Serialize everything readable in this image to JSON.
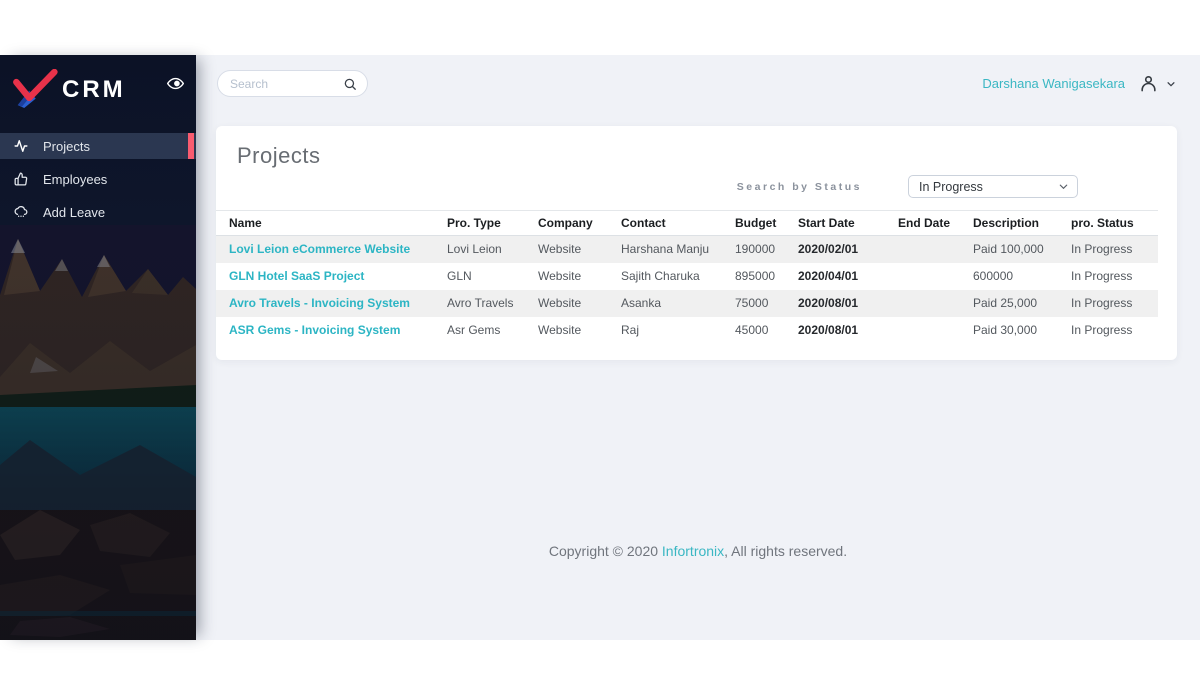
{
  "sidebar": {
    "brand": "CRM",
    "items": [
      {
        "label": "Projects",
        "active": true
      },
      {
        "label": "Employees",
        "active": false
      },
      {
        "label": "Add Leave",
        "active": false
      }
    ]
  },
  "topbar": {
    "search_placeholder": "Search",
    "user_name": "Darshana Wanigasekara"
  },
  "page": {
    "title": "Projects",
    "filter_label": "Search by Status",
    "filter_value": "In Progress"
  },
  "table": {
    "columns": [
      "Name",
      "Pro. Type",
      "Company",
      "Contact",
      "Budget",
      "Start Date",
      "End Date",
      "Description",
      "pro. Status"
    ],
    "column_keys": [
      "name",
      "type",
      "company",
      "contact",
      "budget",
      "start",
      "end",
      "description",
      "status"
    ],
    "rows": [
      {
        "name": "Lovi Leion eCommerce Website",
        "type": "Lovi Leion",
        "company": "Website",
        "contact": "Harshana Manju",
        "budget": "190000",
        "start": "2020/02/01",
        "end": "",
        "description": "Paid 100,000",
        "status": "In Progress"
      },
      {
        "name": "GLN Hotel SaaS Project",
        "type": "GLN",
        "company": "Website",
        "contact": "Sajith Charuka",
        "budget": "895000",
        "start": "2020/04/01",
        "end": "",
        "description": "600000",
        "status": "In Progress"
      },
      {
        "name": "Avro Travels - Invoicing System",
        "type": "Avro Travels",
        "company": "Website",
        "contact": "Asanka",
        "budget": "75000",
        "start": "2020/08/01",
        "end": "",
        "description": "Paid 25,000",
        "status": "In Progress"
      },
      {
        "name": "ASR Gems - Invoicing System",
        "type": "Asr Gems",
        "company": "Website",
        "contact": "Raj",
        "budget": "45000",
        "start": "2020/08/01",
        "end": "",
        "description": "Paid 30,000",
        "status": "In Progress"
      }
    ]
  },
  "footer": {
    "prefix": "Copyright © 2020 ",
    "link": "Infortronix",
    "suffix": ", All rights reserved."
  },
  "icons": {
    "sidebar_toggle": "eye",
    "nav_projects": "activity-pulse",
    "nav_employees": "thumbs-up",
    "nav_add_leave": "cloud-drizzle",
    "search": "magnifier",
    "user": "person-silhouette",
    "caret": "chevron-down"
  },
  "colors": {
    "accent_teal": "#2cb5c4",
    "accent_pink": "#f95c70",
    "sidebar_navy": "#0c1226",
    "main_bg": "#f0f2f7",
    "stripe": "#f0f0f0"
  }
}
